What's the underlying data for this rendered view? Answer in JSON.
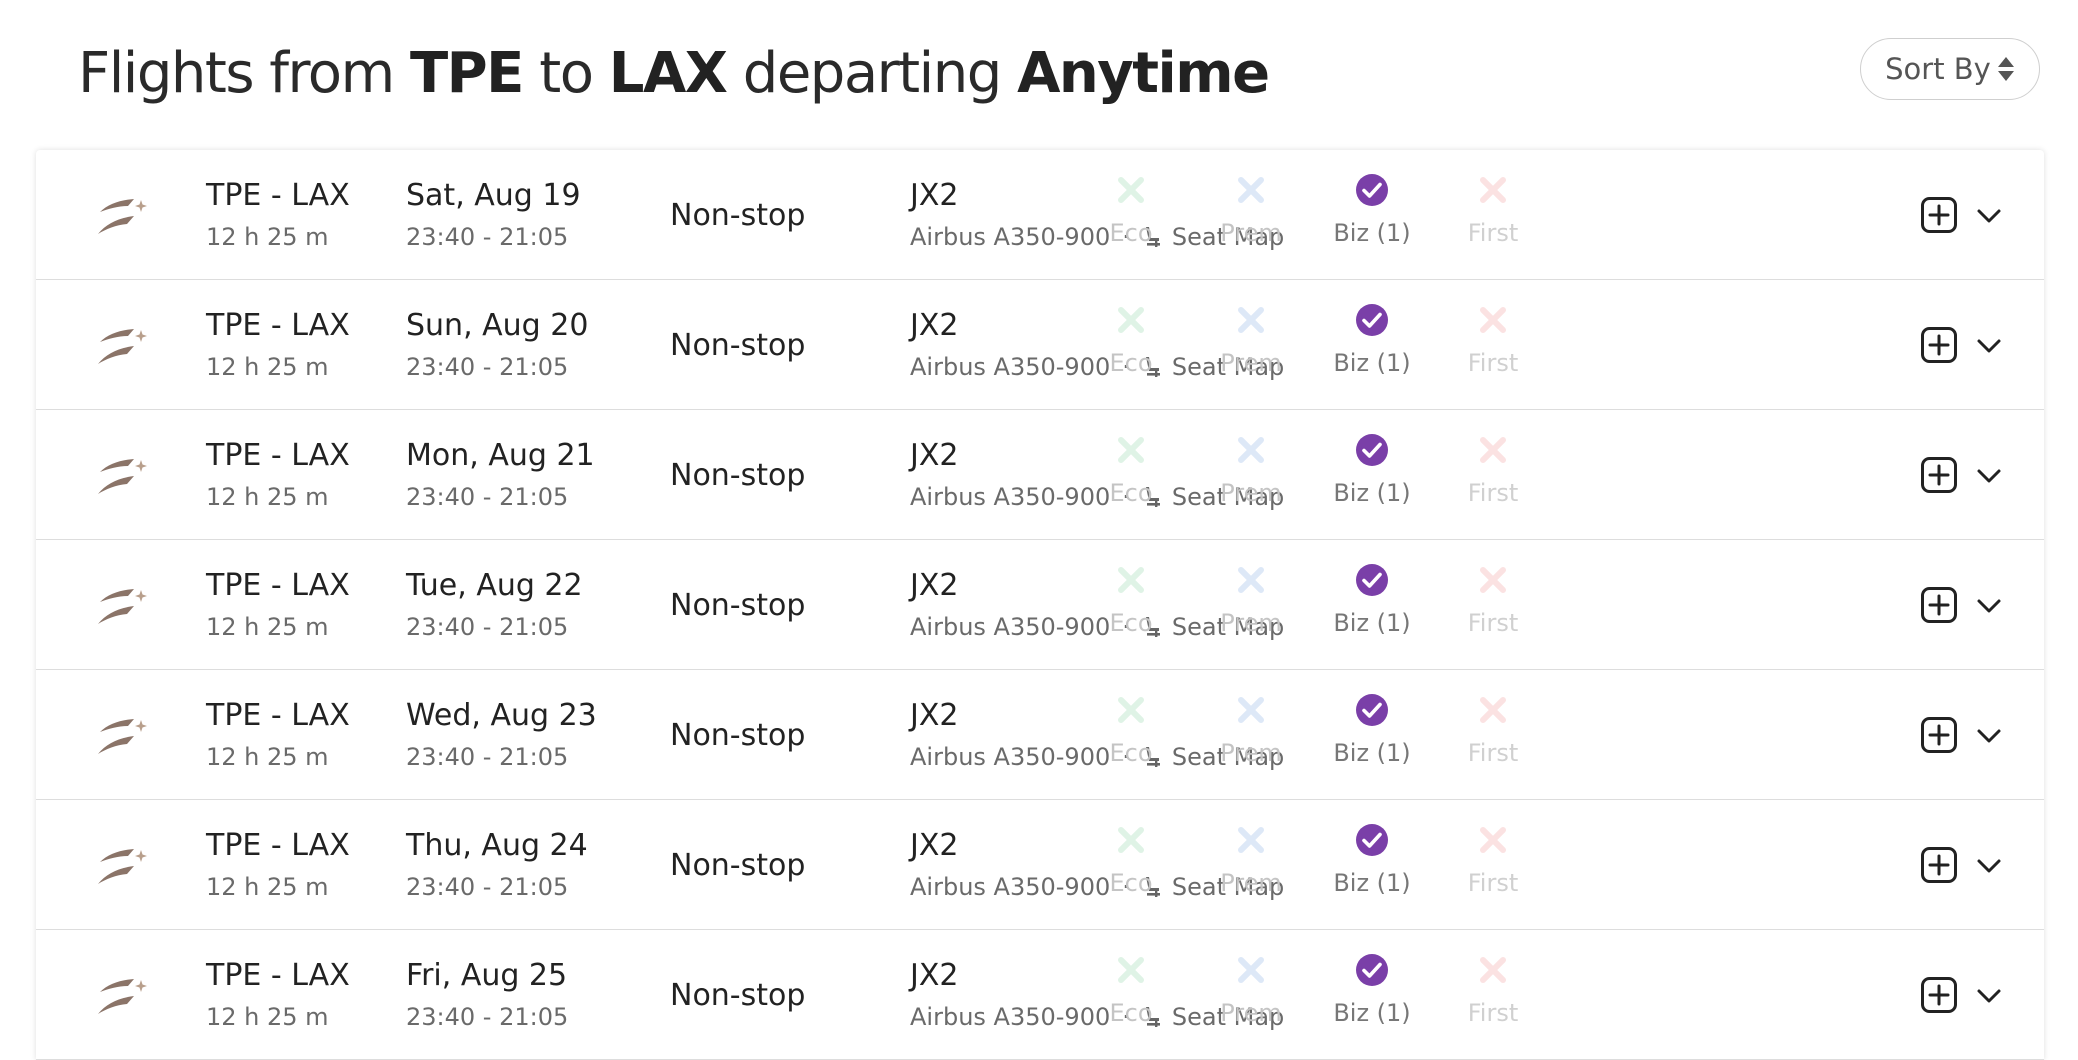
{
  "header": {
    "title_prefix": "Flights from",
    "origin": "TPE",
    "title_to": "to",
    "destination": "LAX",
    "title_departing": "departing",
    "departure_window": "Anytime",
    "sort_label": "Sort By"
  },
  "colors": {
    "eco_icon": "#dff3e6",
    "prem_icon": "#dde8f7",
    "biz_icon": "#7a3fa8",
    "first_icon": "#fbe2e2",
    "logo_primary": "#8b7468",
    "logo_star": "#b89f8c"
  },
  "icons": {
    "logo": "airline-logo-icon",
    "seat": "seat-icon",
    "unavailable": "x-icon",
    "available": "check-circle-icon",
    "add": "plus-square-icon",
    "expand": "chevron-down-icon"
  },
  "flights": [
    {
      "route": "TPE - LAX",
      "duration": "12 h 25 m",
      "date": "Sat, Aug 19",
      "times": "23:40 - 21:05",
      "stops": "Non-stop",
      "flight_no": "JX2",
      "aircraft": "Airbus A350-900",
      "separator": "·",
      "seat_map": "Seat Map",
      "eco": "Eco",
      "prem": "Prem",
      "biz": "Biz (1)",
      "first": "First",
      "eco_available": false,
      "prem_available": false,
      "biz_available": true,
      "first_available": false
    },
    {
      "route": "TPE - LAX",
      "duration": "12 h 25 m",
      "date": "Sun, Aug 20",
      "times": "23:40 - 21:05",
      "stops": "Non-stop",
      "flight_no": "JX2",
      "aircraft": "Airbus A350-900",
      "separator": "·",
      "seat_map": "Seat Map",
      "eco": "Eco",
      "prem": "Prem",
      "biz": "Biz (1)",
      "first": "First",
      "eco_available": false,
      "prem_available": false,
      "biz_available": true,
      "first_available": false
    },
    {
      "route": "TPE - LAX",
      "duration": "12 h 25 m",
      "date": "Mon, Aug 21",
      "times": "23:40 - 21:05",
      "stops": "Non-stop",
      "flight_no": "JX2",
      "aircraft": "Airbus A350-900",
      "separator": "·",
      "seat_map": "Seat Map",
      "eco": "Eco",
      "prem": "Prem",
      "biz": "Biz (1)",
      "first": "First",
      "eco_available": false,
      "prem_available": false,
      "biz_available": true,
      "first_available": false
    },
    {
      "route": "TPE - LAX",
      "duration": "12 h 25 m",
      "date": "Tue, Aug 22",
      "times": "23:40 - 21:05",
      "stops": "Non-stop",
      "flight_no": "JX2",
      "aircraft": "Airbus A350-900",
      "separator": "·",
      "seat_map": "Seat Map",
      "eco": "Eco",
      "prem": "Prem",
      "biz": "Biz (1)",
      "first": "First",
      "eco_available": false,
      "prem_available": false,
      "biz_available": true,
      "first_available": false
    },
    {
      "route": "TPE - LAX",
      "duration": "12 h 25 m",
      "date": "Wed, Aug 23",
      "times": "23:40 - 21:05",
      "stops": "Non-stop",
      "flight_no": "JX2",
      "aircraft": "Airbus A350-900",
      "separator": "·",
      "seat_map": "Seat Map",
      "eco": "Eco",
      "prem": "Prem",
      "biz": "Biz (1)",
      "first": "First",
      "eco_available": false,
      "prem_available": false,
      "biz_available": true,
      "first_available": false
    },
    {
      "route": "TPE - LAX",
      "duration": "12 h 25 m",
      "date": "Thu, Aug 24",
      "times": "23:40 - 21:05",
      "stops": "Non-stop",
      "flight_no": "JX2",
      "aircraft": "Airbus A350-900",
      "separator": "·",
      "seat_map": "Seat Map",
      "eco": "Eco",
      "prem": "Prem",
      "biz": "Biz (1)",
      "first": "First",
      "eco_available": false,
      "prem_available": false,
      "biz_available": true,
      "first_available": false
    },
    {
      "route": "TPE - LAX",
      "duration": "12 h 25 m",
      "date": "Fri, Aug 25",
      "times": "23:40 - 21:05",
      "stops": "Non-stop",
      "flight_no": "JX2",
      "aircraft": "Airbus A350-900",
      "separator": "·",
      "seat_map": "Seat Map",
      "eco": "Eco",
      "prem": "Prem",
      "biz": "Biz (1)",
      "first": "First",
      "eco_available": false,
      "prem_available": false,
      "biz_available": true,
      "first_available": false
    }
  ]
}
